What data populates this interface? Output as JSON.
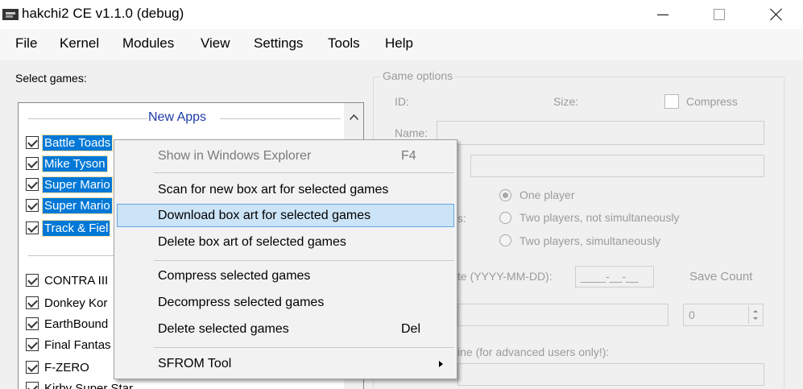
{
  "window": {
    "title": "hakchi2 CE v1.1.0 (debug)"
  },
  "menubar": [
    "File",
    "Kernel",
    "Modules",
    "View",
    "Settings",
    "Tools",
    "Help"
  ],
  "left_panel": {
    "label": "Select games:",
    "group_header": "New Apps",
    "selected_games": [
      "Battle Toads",
      "Mike Tyson",
      "Super Mario",
      "Super Mario",
      "Track & Fiel"
    ],
    "games": [
      "CONTRA III",
      "Donkey Kor",
      "EarthBound",
      "Final Fantas",
      "F-ZERO",
      "Kirby Super Star"
    ]
  },
  "game_options": {
    "title": "Game options",
    "id_label": "ID:",
    "size_label": "Size:",
    "compress_label": "Compress",
    "name_label": "Name:",
    "players_label": "s:",
    "radio_one": "One player",
    "radio_two_not_sim": "Two players, not simultaneously",
    "radio_two_sim": "Two players, simultaneously",
    "release_date_label": "te (YYYY-MM-DD):",
    "release_date_value": "____-__-__",
    "save_count_label": "Save Count",
    "save_count_value": "0",
    "cmdline_label": "ine (for advanced users only!):"
  },
  "context_menu": {
    "items": [
      {
        "label": "Show in Windows Explorer",
        "shortcut": "F4",
        "disabled": true
      },
      {
        "label": "Scan for new box art for selected games",
        "shortcut": ""
      },
      {
        "label": "Download box art for selected games",
        "shortcut": "",
        "highlighted": true
      },
      {
        "label": "Delete box art of selected games",
        "shortcut": ""
      },
      {
        "label": "Compress selected games",
        "shortcut": ""
      },
      {
        "label": "Decompress selected games",
        "shortcut": ""
      },
      {
        "label": "Delete selected games",
        "shortcut": "Del"
      },
      {
        "label": "SFROM Tool",
        "shortcut": "",
        "submenu": true
      }
    ]
  },
  "colors": {
    "selection": "#0078d7",
    "highlight_bg": "#cce4f7",
    "highlight_border": "#66a7e8",
    "group_header": "#1e3aa8"
  }
}
